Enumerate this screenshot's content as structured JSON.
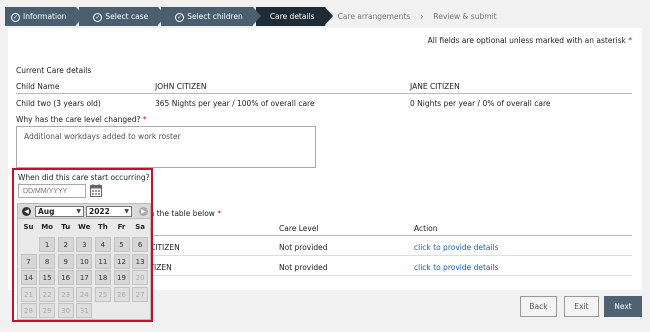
{
  "steps": {
    "completed": [
      "Information",
      "Select case",
      "Select children"
    ],
    "active": "Care details",
    "upcoming": [
      "Care arrangements",
      "Review & submit"
    ]
  },
  "hint": "All fields are optional unless marked with an asterisk",
  "current": {
    "heading": "Current Care details",
    "col_child": "Child Name",
    "col_parent1": "JOHN CITIZEN",
    "col_parent2": "JANE CITIZEN",
    "child": "Child two (3 years old)",
    "parent1_care": "365 Nights per year / 100% of overall care",
    "parent2_care": "0 Nights per year / 0% of overall care"
  },
  "reason": {
    "label": "Why has the care level changed?",
    "value": "Additional workdays added to work roster"
  },
  "start": {
    "label": "When did this care start occurring?",
    "placeholder": "DD/MM/YYYY"
  },
  "provide": {
    "label_tail": "r in the table below",
    "headers": {
      "parent": "r",
      "care_level": "Care Level",
      "action": "Action"
    },
    "rows": [
      {
        "parent": "N CITIZEN",
        "care_level": "Not provided",
        "action": "click to provide details"
      },
      {
        "parent": "CITIZEN",
        "care_level": "Not provided",
        "action": "click to provide details"
      }
    ]
  },
  "calendar": {
    "month": "Aug",
    "year": "2022",
    "weekdays": [
      "Su",
      "Mo",
      "Tu",
      "We",
      "Th",
      "Fr",
      "Sa"
    ],
    "weeks": [
      [
        "",
        "1",
        "2",
        "3",
        "4",
        "5",
        "6"
      ],
      [
        "7",
        "8",
        "9",
        "10",
        "11",
        "12",
        "13"
      ],
      [
        "14",
        "15",
        "16",
        "17",
        "18",
        "19",
        "20"
      ],
      [
        "21",
        "22",
        "23",
        "24",
        "25",
        "26",
        "27"
      ],
      [
        "28",
        "29",
        "30",
        "31",
        "",
        "",
        ""
      ]
    ],
    "enabled_through": 19
  },
  "buttons": {
    "back": "Back",
    "exit": "Exit",
    "next": "Next"
  },
  "colors": {
    "accent": "#4e6273",
    "required": "#c8102e",
    "link": "#1a5fb4"
  }
}
